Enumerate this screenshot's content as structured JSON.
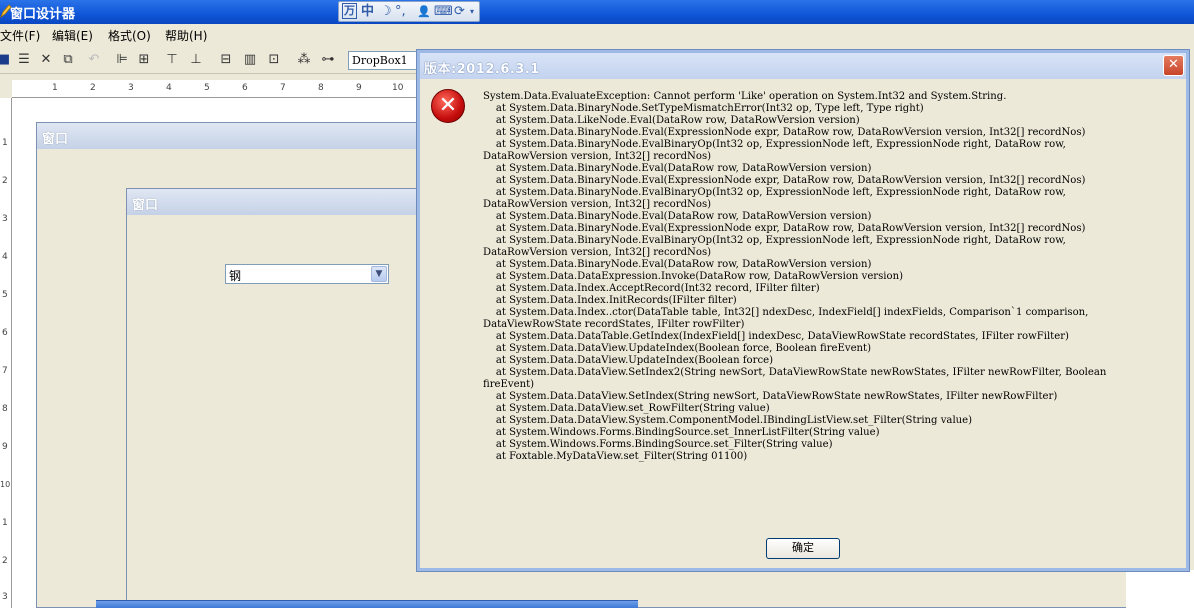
{
  "main_window": {
    "title": "窗口设计器"
  },
  "ime_bar": {
    "items": [
      "万",
      "中",
      "☽",
      "°,",
      "👤",
      "⌨",
      "⟳"
    ]
  },
  "menu": [
    {
      "label": "文件(F)"
    },
    {
      "label": "编辑(E)"
    },
    {
      "label": "格式(O)"
    },
    {
      "label": "帮助(H)"
    }
  ],
  "toolbar": {
    "icons": [
      "save-icon",
      "properties-icon",
      "delete-icon",
      "copy-icon",
      "undo-icon",
      "align-left-icon",
      "align-center-icon",
      "align-top-icon",
      "align-bottom-icon",
      "same-width-icon",
      "same-height-icon",
      "same-size-icon",
      "group-icon",
      "tab-order-icon"
    ],
    "control_selector": "DropBox1"
  },
  "ruler": {
    "top_numbers": [
      "1",
      "2",
      "3",
      "4",
      "5",
      "6",
      "7",
      "8",
      "9",
      "10"
    ],
    "left_numbers": [
      "1",
      "2",
      "3",
      "4",
      "5",
      "6",
      "7",
      "8",
      "9",
      "10",
      "1",
      "2",
      "3"
    ]
  },
  "design_windows": [
    {
      "title": "窗口"
    },
    {
      "title": "窗口"
    }
  ],
  "combo": {
    "value": "钢"
  },
  "dialog": {
    "title": "版本:2012.6.3.1",
    "close_label": "✕",
    "message": "System.Data.EvaluateException: Cannot perform 'Like' operation on System.Int32 and System.String.\n    at System.Data.BinaryNode.SetTypeMismatchError(Int32 op, Type left, Type right)\n    at System.Data.LikeNode.Eval(DataRow row, DataRowVersion version)\n    at System.Data.BinaryNode.Eval(ExpressionNode expr, DataRow row, DataRowVersion version, Int32[] recordNos)\n    at System.Data.BinaryNode.EvalBinaryOp(Int32 op, ExpressionNode left, ExpressionNode right, DataRow row,\nDataRowVersion version, Int32[] recordNos)\n    at System.Data.BinaryNode.Eval(DataRow row, DataRowVersion version)\n    at System.Data.BinaryNode.Eval(ExpressionNode expr, DataRow row, DataRowVersion version, Int32[] recordNos)\n    at System.Data.BinaryNode.EvalBinaryOp(Int32 op, ExpressionNode left, ExpressionNode right, DataRow row,\nDataRowVersion version, Int32[] recordNos)\n    at System.Data.BinaryNode.Eval(DataRow row, DataRowVersion version)\n    at System.Data.BinaryNode.Eval(ExpressionNode expr, DataRow row, DataRowVersion version, Int32[] recordNos)\n    at System.Data.BinaryNode.EvalBinaryOp(Int32 op, ExpressionNode left, ExpressionNode right, DataRow row,\nDataRowVersion version, Int32[] recordNos)\n    at System.Data.BinaryNode.Eval(DataRow row, DataRowVersion version)\n    at System.Data.DataExpression.Invoke(DataRow row, DataRowVersion version)\n    at System.Data.Index.AcceptRecord(Int32 record, IFilter filter)\n    at System.Data.Index.InitRecords(IFilter filter)\n    at System.Data.Index..ctor(DataTable table, Int32[] ndexDesc, IndexField[] indexFields, Comparison`1 comparison,\nDataViewRowState recordStates, IFilter rowFilter)\n    at System.Data.DataTable.GetIndex(IndexField[] indexDesc, DataViewRowState recordStates, IFilter rowFilter)\n    at System.Data.DataView.UpdateIndex(Boolean force, Boolean fireEvent)\n    at System.Data.DataView.UpdateIndex(Boolean force)\n    at System.Data.DataView.SetIndex2(String newSort, DataViewRowState newRowStates, IFilter newRowFilter, Boolean\nfireEvent)\n    at System.Data.DataView.SetIndex(String newSort, DataViewRowState newRowStates, IFilter newRowFilter)\n    at System.Data.DataView.set_RowFilter(String value)\n    at System.Data.DataView.System.ComponentModel.IBindingListView.set_Filter(String value)\n    at System.Windows.Forms.BindingSource.set_InnerListFilter(String value)\n    at System.Windows.Forms.BindingSource.set_Filter(String value)\n    at Foxtable.MyDataView.set_Filter(String 01100)",
    "ok_label": "确定"
  }
}
